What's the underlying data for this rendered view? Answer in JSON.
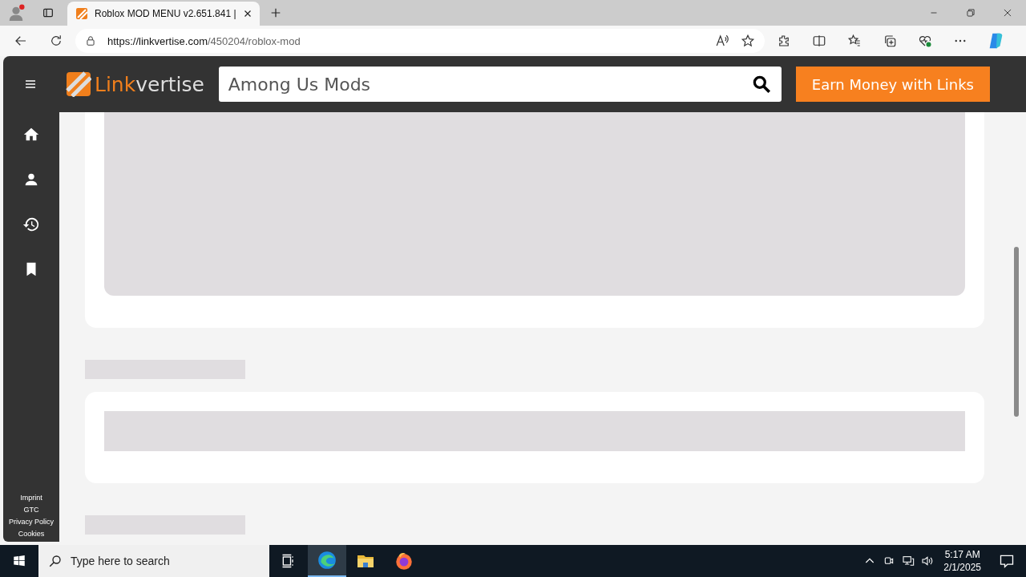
{
  "browser": {
    "tab_title": "Roblox MOD MENU v2.651.841 |",
    "url_host": "https://linkvertise.com",
    "url_path": "/450204/roblox-mod"
  },
  "header": {
    "logo": {
      "accent": "Link",
      "rest": "vertise"
    },
    "search": {
      "value": "Among Us Mods"
    },
    "cta": "Earn Money with Links"
  },
  "sidebar": {
    "items": [
      {
        "kind": "home"
      },
      {
        "kind": "person"
      },
      {
        "kind": "history"
      },
      {
        "kind": "bookmark"
      }
    ],
    "footer_links": [
      "Imprint",
      "GTC",
      "Privacy Policy",
      "Cookies"
    ]
  },
  "taskbar": {
    "search_placeholder": "Type here to search",
    "time": "5:17 AM",
    "date": "2/1/2025"
  }
}
